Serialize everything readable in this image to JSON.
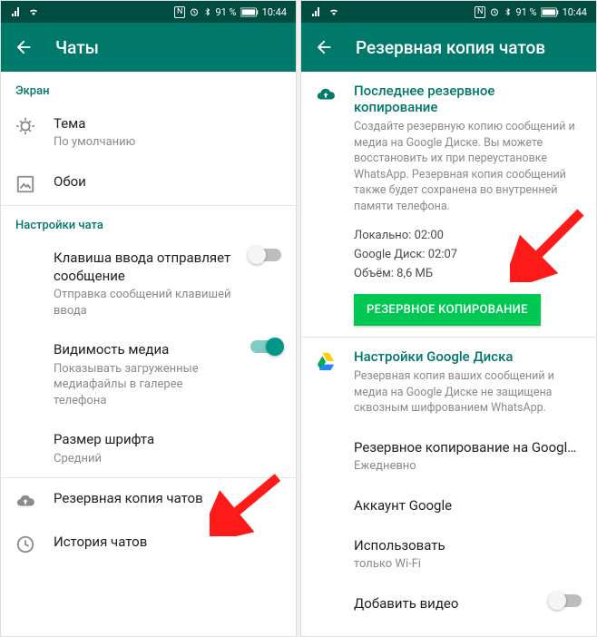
{
  "status": {
    "nfc": "N",
    "alarm": "⏰",
    "bt": "ᚼ",
    "battery": "91 %",
    "time": "10:44"
  },
  "left": {
    "title": "Чаты",
    "section_screen": "Экран",
    "theme": {
      "title": "Тема",
      "sub": "По умолчанию"
    },
    "wallpaper": {
      "title": "Обои"
    },
    "section_chat": "Настройки чата",
    "enter_send": {
      "title": "Клавиша ввода отправляет сообщение",
      "sub": "Отправка сообщений клавишей ввода"
    },
    "media_vis": {
      "title": "Видимость медиа",
      "sub": "Показывать загруженные медиафайлы в галерее телефона"
    },
    "font_size": {
      "title": "Размер шрифта",
      "sub": "Средний"
    },
    "backup": {
      "title": "Резервная копия чатов"
    },
    "history": {
      "title": "История чатов"
    }
  },
  "right": {
    "title": "Резервная копия чатов",
    "last_backup": {
      "heading": "Последнее резервное копирование",
      "desc": "Создайте резервную копию сообщений и медиа на Google Диске. Вы можете восстановить их при переустановке WhatsApp. Резервная копия сообщений также будет сохранена во внутренней памяти телефона.",
      "local": "Локально: 02:00",
      "google": "Google Диск: 02:07",
      "size": "Объём: 8,6 МБ",
      "button": "РЕЗЕРВНОЕ КОПИРОВАНИЕ"
    },
    "gdrive": {
      "heading": "Настройки Google Диска",
      "desc": "Резервная копия ваших сообщений и медиа на Google Диске не защищена сквозным шифрованием WhatsApp."
    },
    "schedule": {
      "title": "Резервное копирование на Googl…",
      "sub": "Ежедневно"
    },
    "account": {
      "title": "Аккаунт Google"
    },
    "network": {
      "title": "Использовать",
      "sub": "только Wi-Fi"
    },
    "video": {
      "title": "Добавить видео"
    }
  }
}
